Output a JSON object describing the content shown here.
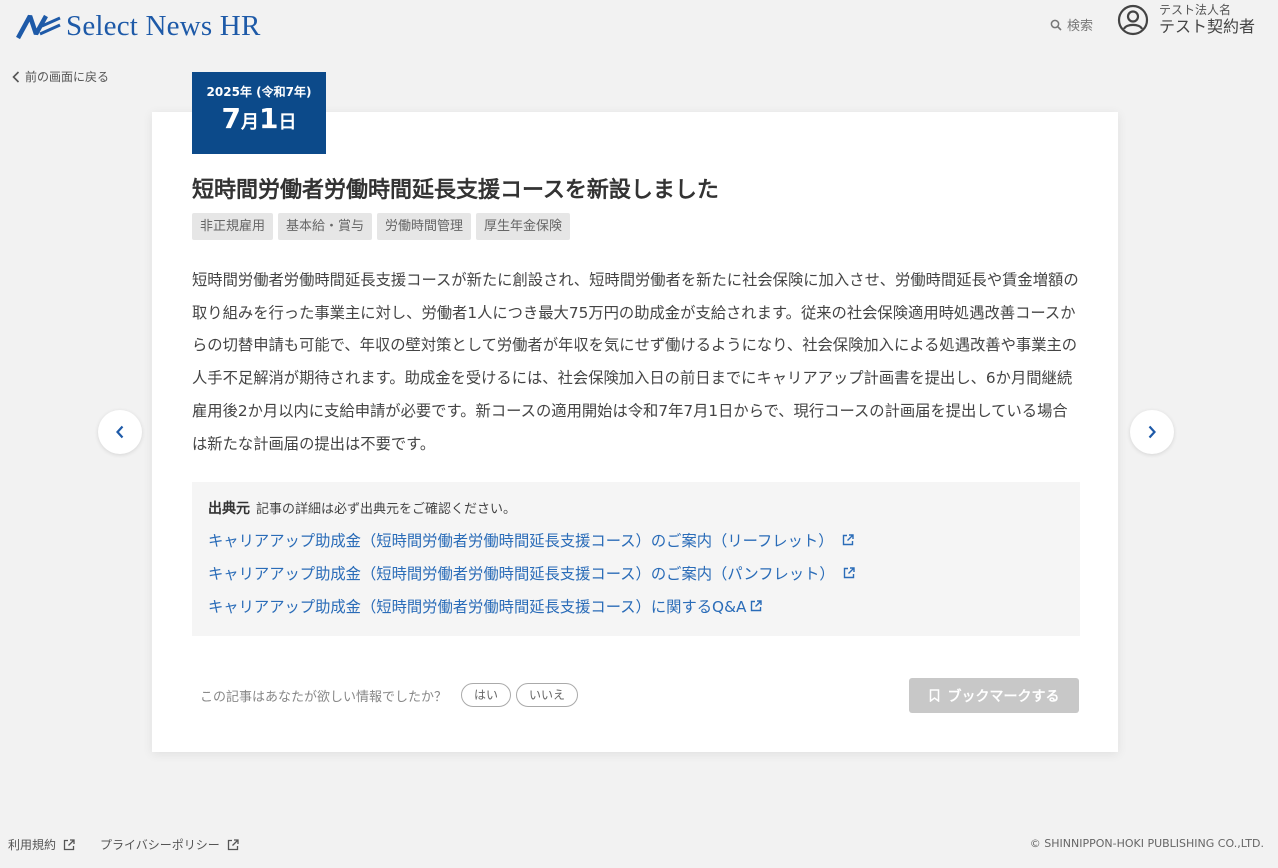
{
  "header": {
    "logo_text": "Select News HR",
    "search_label": "検索",
    "user_company": "テスト法人名",
    "user_name": "テスト契約者"
  },
  "nav": {
    "back_label": "前の画面に戻る"
  },
  "article": {
    "date_year": "2025年 (令和7年)",
    "date_month": "7",
    "date_month_unit": "月",
    "date_day": "1",
    "date_day_unit": "日",
    "title": "短時間労働者労働時間延長支援コースを新設しました",
    "tags": [
      "非正規雇用",
      "基本給・賞与",
      "労働時間管理",
      "厚生年金保険"
    ],
    "body": "短時間労働者労働時間延長支援コースが新たに創設され、短時間労働者を新たに社会保険に加入させ、労働時間延長や賃金増額の取り組みを行った事業主に対し、労働者1人につき最大75万円の助成金が支給されます。従来の社会保険適用時処遇改善コースからの切替申請も可能で、年収の壁対策として労働者が年収を気にせず働けるようになり、社会保険加入による処遇改善や事業主の人手不足解消が期待されます。助成金を受けるには、社会保険加入日の前日までにキャリアアップ計画書を提出し、6か月間継続雇用後2か月以内に支給申請が必要です。新コースの適用開始は令和7年7月1日からで、現行コースの計画届を提出している場合は新たな計画届の提出は不要です。",
    "source": {
      "heading": "出典元",
      "note": "記事の詳細は必ず出典元をご確認ください。",
      "links": [
        "キャリアアップ助成金（短時間労働者労働時間延長支援コース）のご案内（リーフレット）",
        "キャリアアップ助成金（短時間労働者労働時間延長支援コース）のご案内（パンフレット）",
        "キャリアアップ助成金（短時間労働者労働時間延長支援コース）に関するQ&A"
      ]
    },
    "feedback": {
      "question": "この記事はあなたが欲しい情報でしたか？",
      "yes": "はい",
      "no": "いいえ"
    },
    "bookmark_label": "ブックマークする"
  },
  "footer": {
    "terms": "利用規約",
    "privacy": "プライバシーポリシー",
    "copyright": "© SHINNIPPON-HOKI PUBLISHING CO.,LTD."
  },
  "colors": {
    "brand": "#1e5aa8",
    "date_badge": "#0c4a8a",
    "link": "#2a6cb8",
    "bookmark_disabled": "#c8c8c8"
  }
}
